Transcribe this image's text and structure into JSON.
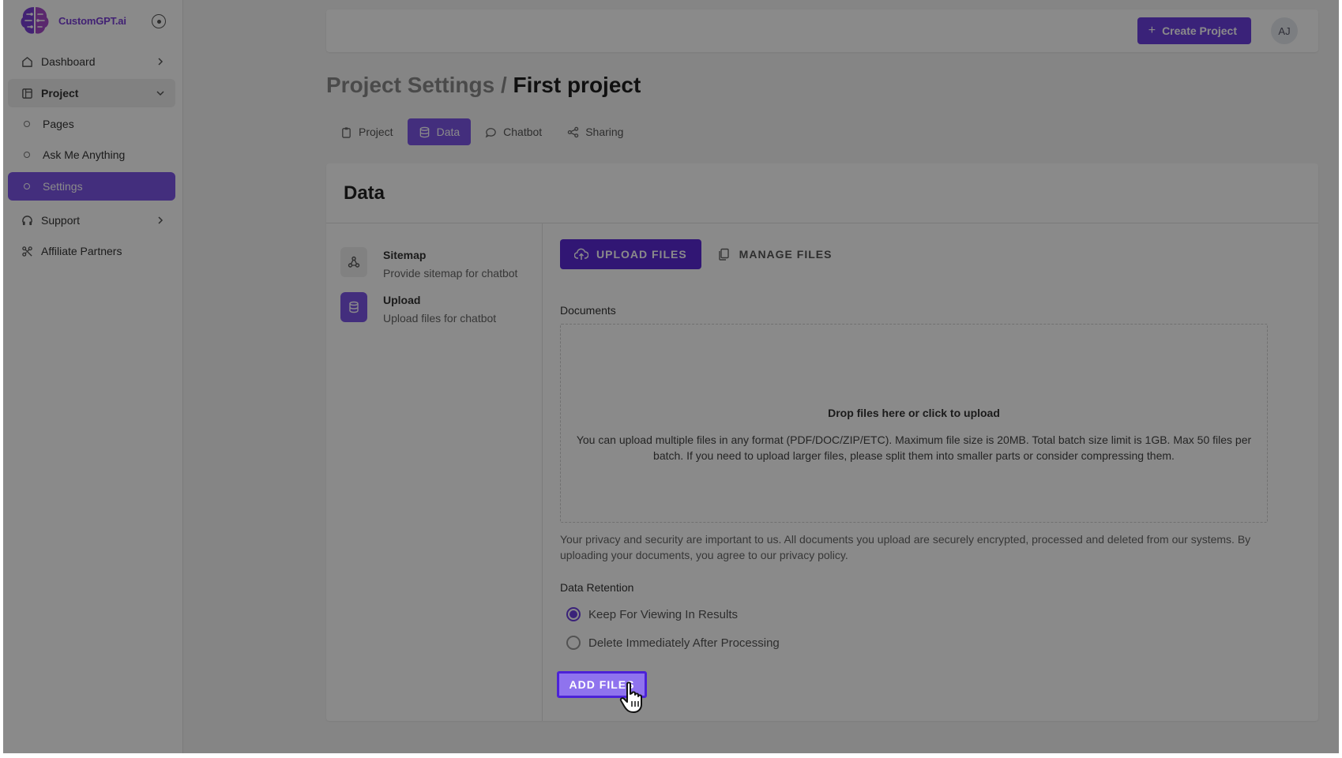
{
  "brand": {
    "name": "CustomGPT.ai"
  },
  "sidebar": {
    "items": [
      {
        "label": "Dashboard",
        "icon": "home-icon"
      },
      {
        "label": "Project",
        "icon": "project-icon"
      },
      {
        "label": "Pages"
      },
      {
        "label": "Ask Me Anything"
      },
      {
        "label": "Settings"
      },
      {
        "label": "Support",
        "icon": "headset-icon"
      },
      {
        "label": "Affiliate Partners",
        "icon": "affiliate-icon"
      }
    ]
  },
  "header": {
    "create_label": "Create Project",
    "avatar_initials": "AJ"
  },
  "page": {
    "crumb": "Project Settings /",
    "current": "First project"
  },
  "tabs": [
    {
      "label": "Project"
    },
    {
      "label": "Data"
    },
    {
      "label": "Chatbot"
    },
    {
      "label": "Sharing"
    }
  ],
  "card": {
    "title": "Data",
    "sources": [
      {
        "name": "Sitemap",
        "desc": "Provide sitemap for chatbot"
      },
      {
        "name": "Upload",
        "desc": "Upload files for chatbot"
      }
    ],
    "upload_tab": "UPLOAD FILES",
    "manage_tab": "MANAGE FILES",
    "documents_label": "Documents",
    "drop_title": "Drop files here or click to upload",
    "drop_desc": "You can upload multiple files in any format (PDF/DOC/ZIP/ETC). Maximum file size is 20MB. Total batch size limit is 1GB. Max 50 files per batch. If you need to upload larger files, please split them into smaller parts or consider compressing them.",
    "privacy": "Your privacy and security are important to us. All documents you upload are securely encrypted, processed and deleted from our systems. By uploading your documents, you agree to our privacy policy.",
    "retention_label": "Data Retention",
    "retention_options": [
      "Keep For Viewing In Results",
      "Delete Immediately After Processing"
    ],
    "add_files": "ADD FILES"
  },
  "colors": {
    "accent": "#6c3fe0",
    "active_nav": "#7d55e8",
    "upload_tab": "#5b2ad6"
  }
}
